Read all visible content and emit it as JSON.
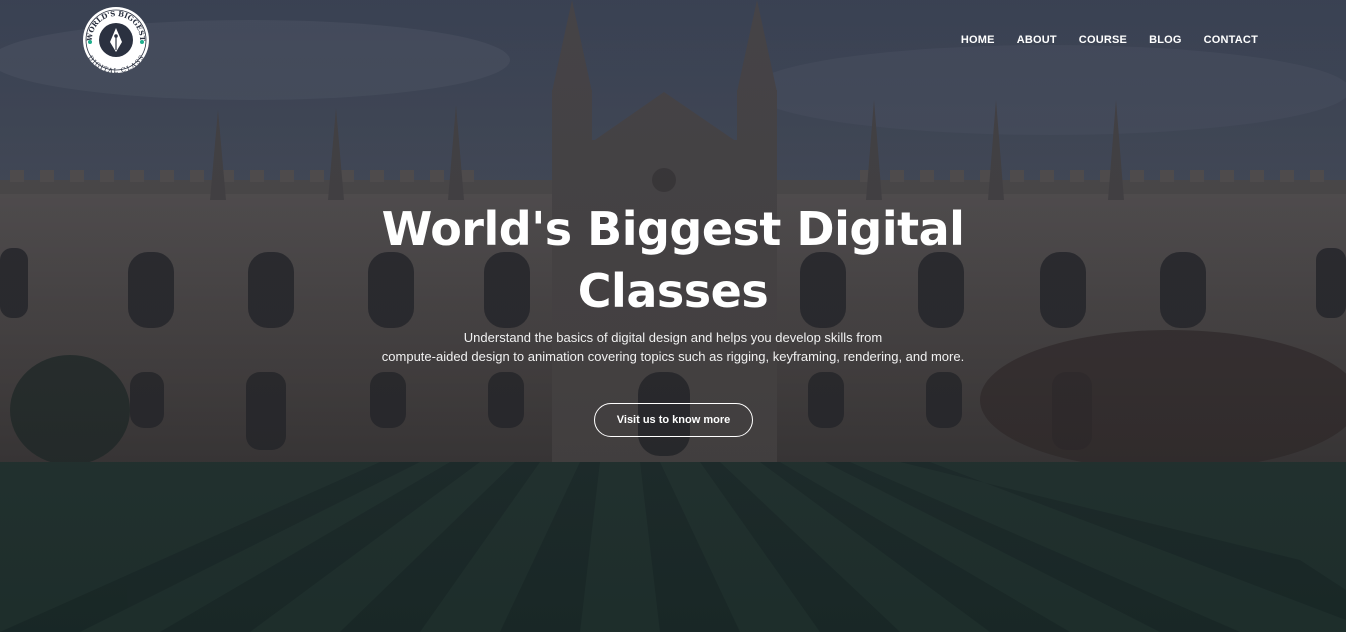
{
  "logo": {
    "top_text": "WORLD'S BIGGEST",
    "bottom_text": "DIGITAL CLASS",
    "icon": "pen-nib-icon"
  },
  "nav": {
    "items": [
      "HOME",
      "ABOUT",
      "COURSE",
      "BLOG",
      "CONTACT"
    ]
  },
  "hero": {
    "title_line1": "World's Biggest Digital",
    "title_line2": "Classes",
    "subtitle_line1": "Understand the basics of digital design and helps you develop skills from",
    "subtitle_line2": "compute-aided design to animation covering topics such as rigging, keyframing, rendering, and more.",
    "cta_label": "Visit us to know more"
  },
  "colors": {
    "overlay": "#1e2434",
    "text": "#ffffff",
    "logo_accent": "#1fae8c"
  }
}
